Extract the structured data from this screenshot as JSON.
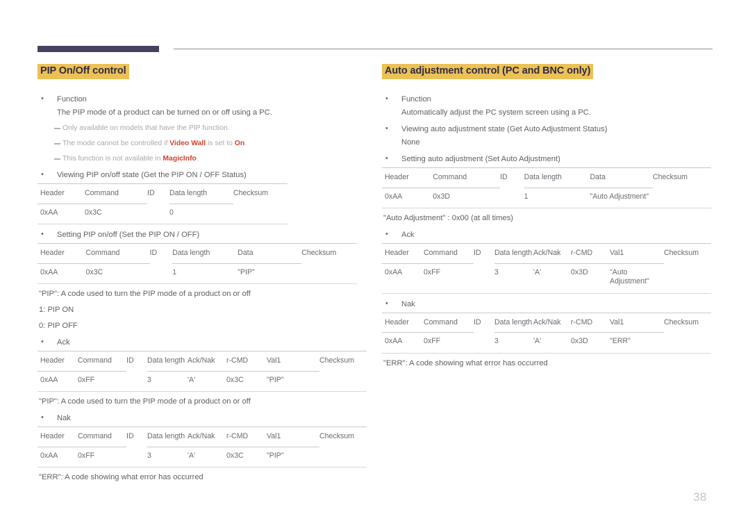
{
  "page": {
    "number": "38",
    "accent_highlight": "#ecc155",
    "accent_heading_text": "#2f2b45",
    "accent_red": "#d2432e",
    "rule_dark": "#46415e",
    "body_text": "#5f5f66"
  },
  "left": {
    "heading": "PIP On/Off control",
    "function_label": "Function",
    "function_text": "The PIP mode of a product can be turned on or off using a PC.",
    "notes": [
      {
        "pre": "Only available on models that have the PIP function.",
        "bold": "",
        "post": ""
      },
      {
        "pre": "The mode cannot be controlled if ",
        "bold": "Video Wall",
        "post": " is set to ",
        "bold2": "On",
        "post2": "."
      },
      {
        "pre": "This function is not available in ",
        "bold": "MagicInfo",
        "post": "."
      }
    ],
    "get_label": "Viewing PIP on/off state (Get the PIP ON / OFF Status)",
    "get_table": {
      "headers": [
        "Header",
        "Command",
        "ID",
        "Data length",
        "Checksum"
      ],
      "row": [
        "0xAA",
        "0x3C",
        "",
        "0",
        ""
      ]
    },
    "set_label": "Setting PIP on/off (Set the PIP ON / OFF)",
    "set_table": {
      "headers": [
        "Header",
        "Command",
        "ID",
        "Data length",
        "Data",
        "Checksum"
      ],
      "row": [
        "0xAA",
        "0x3C",
        "",
        "1",
        "\"PIP\"",
        ""
      ]
    },
    "pip_desc": "\"PIP\": A code used to turn the PIP mode of a product on or off",
    "pip_on": "1: PIP ON",
    "pip_off": "0: PIP OFF",
    "ack_label": "Ack",
    "ack_table": {
      "headers": [
        "Header",
        "Command",
        "ID",
        "Data length",
        "Ack/Nak",
        "r-CMD",
        "Val1",
        "Checksum"
      ],
      "row": [
        "0xAA",
        "0xFF",
        "",
        "3",
        "'A'",
        "0x3C",
        "\"PIP\"",
        ""
      ]
    },
    "pip_desc2": "\"PIP\": A code used to turn the PIP mode of a product on or off",
    "nak_label": "Nak",
    "nak_table": {
      "headers": [
        "Header",
        "Command",
        "ID",
        "Data length",
        "Ack/Nak",
        "r-CMD",
        "Val1",
        "Checksum"
      ],
      "row": [
        "0xAA",
        "0xFF",
        "",
        "3",
        "'A'",
        "0x3C",
        "\"PIP\"",
        ""
      ]
    },
    "err_desc": "\"ERR\": A code showing what error has occurred"
  },
  "right": {
    "heading": "Auto adjustment control (PC and BNC only)",
    "function_label": "Function",
    "function_text": "Automatically adjust the PC system screen using a PC.",
    "get_label": "Viewing auto adjustment state (Get Auto Adjustment Status)",
    "get_value": "None",
    "set_label": "Setting auto adjustment (Set Auto Adjustment)",
    "set_table": {
      "headers": [
        "Header",
        "Command",
        "ID",
        "Data length",
        "Data",
        "Checksum"
      ],
      "row": [
        "0xAA",
        "0x3D",
        "",
        "1",
        "\"Auto Adjustment\"",
        ""
      ]
    },
    "auto_desc": "\"Auto Adjustment\" : 0x00 (at all times)",
    "ack_label": "Ack",
    "ack_table": {
      "headers": [
        "Header",
        "Command",
        "ID",
        "Data length",
        "Ack/Nak",
        "r-CMD",
        "Val1",
        "Checksum"
      ],
      "row": [
        "0xAA",
        "0xFF",
        "",
        "3",
        "'A'",
        "0x3D",
        "\"Auto Adjustment\"",
        ""
      ]
    },
    "nak_label": "Nak",
    "nak_table": {
      "headers": [
        "Header",
        "Command",
        "ID",
        "Data length",
        "Ack/Nak",
        "r-CMD",
        "Val1",
        "Checksum"
      ],
      "row": [
        "0xAA",
        "0xFF",
        "",
        "3",
        "'A'",
        "0x3D",
        "\"ERR\"",
        ""
      ]
    },
    "err_desc": "\"ERR\": A code showing what error has occurred"
  }
}
